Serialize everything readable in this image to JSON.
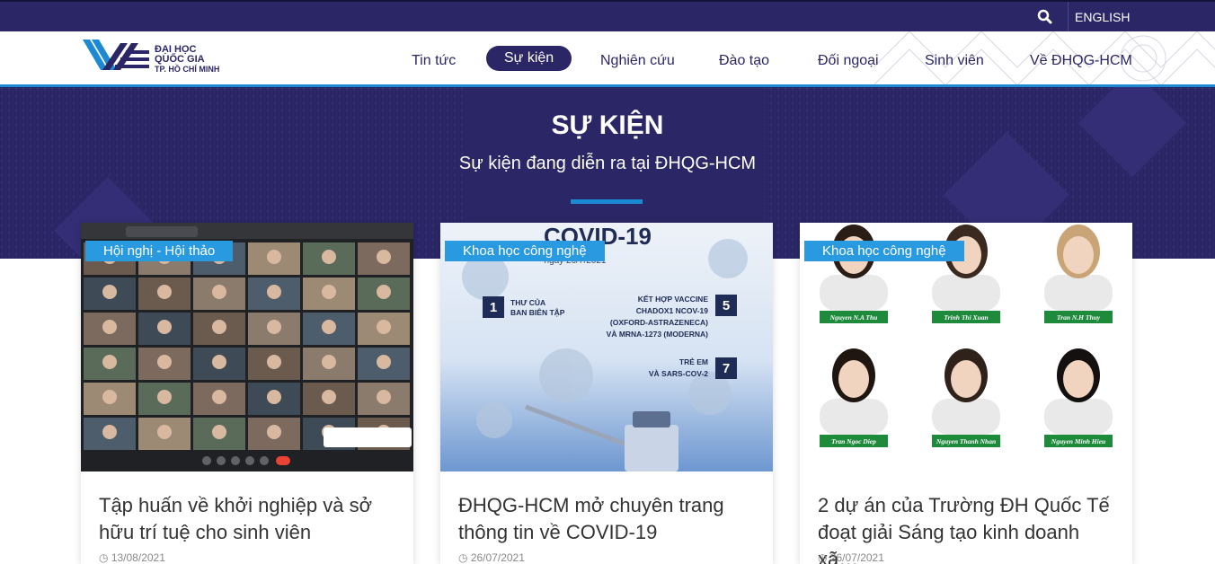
{
  "topbar": {
    "search_icon": "search-icon",
    "language": "ENGLISH"
  },
  "logo": {
    "line1": "ĐẠI HỌC",
    "line2": "QUỐC GIA",
    "line3": "TP. HỒ CHÍ MINH"
  },
  "menu": [
    {
      "label": "Tin tức"
    },
    {
      "label": "Sự kiện",
      "active": true
    },
    {
      "label": "Nghiên cứu"
    },
    {
      "label": "Đào tạo"
    },
    {
      "label": "Đối ngoại"
    },
    {
      "label": "Sinh viên"
    },
    {
      "label": "Về ĐHQG-HCM"
    }
  ],
  "hero": {
    "title": "SỰ KIỆN",
    "subtitle": "Sự kiện đang diễn ra tại ĐHQG-HCM"
  },
  "cards": [
    {
      "category": "Hội nghị - Hội thảo",
      "title": "Tập huấn về khởi nghiệp và sở hữu trí tuệ cho sinh viên",
      "date": "13/08/2021"
    },
    {
      "category": "Khoa học công nghệ",
      "title": "ĐHQG-HCM mở chuyên trang thông tin về COVID-19",
      "date": "26/07/2021",
      "image_text": {
        "heading": "COVID-19",
        "date": "ngày 26/7/2021",
        "items": [
          {
            "num": "1",
            "text": "THƯ CỦA BAN BIÊN TẬP"
          },
          {
            "num": "5",
            "text": "KẾT HỢP VACCINE CHADOX1 NCOV-19 (OXFORD-ASTRAZENECA) VÀ MRNA-1273 (MODERNA)"
          },
          {
            "num": "7",
            "text": "TRẺ EM VÀ SARS-COV-2"
          }
        ]
      }
    },
    {
      "category": "Khoa học công nghệ",
      "title": "2 dự án của Trường ĐH Quốc Tế đoạt giải Sáng tạo kinh doanh xã…",
      "date": "26/07/2021",
      "people": [
        "Nguyen N.A Thu",
        "Trinh Thi Xuan",
        "Tran N.H Thuy",
        "Tran Ngoc Diep",
        "Nguyen Thanh Nhan",
        "Nguyen Minh Hieu"
      ]
    }
  ],
  "colors": {
    "navy": "#2b2665",
    "accent": "#2a9ae0"
  }
}
